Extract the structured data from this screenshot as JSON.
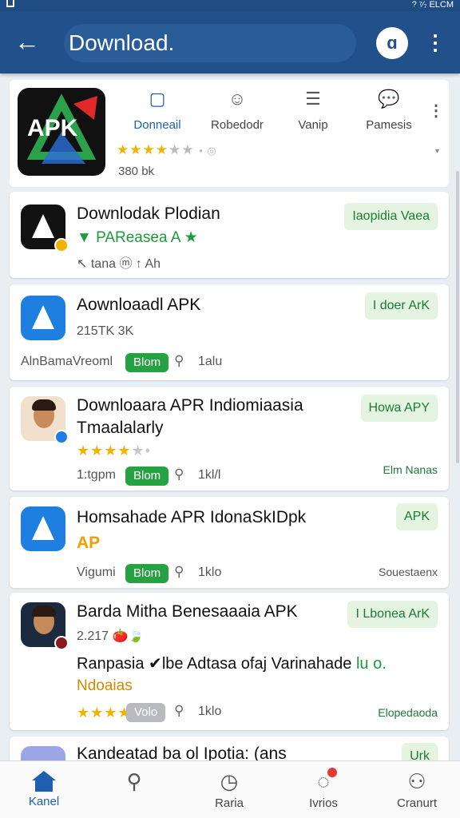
{
  "status_bar": {
    "text": "? ⁷⁄₇ ELCM"
  },
  "appbar": {
    "title": "Download.",
    "back_icon": "←",
    "menu_icon": "⋮",
    "round_icon": "ɑ"
  },
  "top_card": {
    "logo_text": "APK",
    "tabs": [
      {
        "label": "Donneail",
        "icon": "bookmark-icon",
        "glyph": "▢",
        "active": true
      },
      {
        "label": "Robedodr",
        "icon": "face-icon",
        "glyph": "☺",
        "active": false
      },
      {
        "label": "Vanip",
        "icon": "chat-icon",
        "glyph": "☰",
        "active": false
      },
      {
        "label": "Pamesis",
        "icon": "comment-notify-icon",
        "glyph": "💬",
        "active": false
      }
    ],
    "more_glyph": "⋮",
    "rating_glyph": "★★★★",
    "rating_grey": "★★",
    "rating_suffix": "•  ◎",
    "size": "380 bk",
    "caret": "▾"
  },
  "apps": [
    {
      "title": "Downlodak Plodian",
      "line2": "▼ PAReasea A ★",
      "line3": "↖ tana  ⓜ ↑ Ah",
      "chip": "Iaopidia Vaea"
    },
    {
      "title": "Aownloaadl APK",
      "line2": "215TK 3K",
      "meta_left": "AlnBamaVreoml",
      "pill": "Blom",
      "meta_right": "1alu",
      "chip": "I doer ArK"
    },
    {
      "title": "Downloaara APR Indiomiaasia",
      "title2": "Tmaalalarly",
      "stars": "★★★★",
      "stars_grey": "★•",
      "meta_left": "1:tgpm",
      "pill": "Blom",
      "meta_right": "1kl/l",
      "chip": "Howa APY",
      "right_note": "Elm Nanas"
    },
    {
      "title": "Homsahade APR IdonaSkIDpk",
      "line2": "AP",
      "meta_left": "Vigumi",
      "pill": "Blom",
      "meta_right": "1klo",
      "chip": "APK",
      "right_note": "Souestaenx"
    },
    {
      "title": "Barda Mitha Benesaaaia APK",
      "line2": "2.217 🍅🍃",
      "line3": "Ranpasia ✔lbe Adtasa ofaj Varinahade",
      "line3_tail": "lu o.",
      "line4": "Ndoaias",
      "stars": "★★★★",
      "pill": "Volo",
      "meta_right": "1klo",
      "chip": "I Lbonea ArK",
      "right_note": "Elopedaoda"
    },
    {
      "title": "Kandeatad ba ol Ipotia: (ans",
      "chip": "Urk"
    }
  ],
  "bottom_nav": [
    {
      "label": "Kanel",
      "icon": "home-icon",
      "active": true
    },
    {
      "label": "",
      "icon": "search-icon",
      "active": false
    },
    {
      "label": "Raria",
      "icon": "clock-icon",
      "active": false
    },
    {
      "label": "Ivrios",
      "icon": "notification-icon",
      "active": false
    },
    {
      "label": "Cranurt",
      "icon": "user-icon",
      "active": false
    }
  ]
}
